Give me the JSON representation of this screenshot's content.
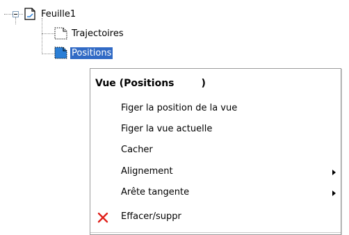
{
  "tree": {
    "root": {
      "label": "Feuille1",
      "expanded": true,
      "icon": "sheet-icon"
    },
    "children": [
      {
        "label": "Trajectoires",
        "icon": "view-icon",
        "selected": false
      },
      {
        "label": "Positions",
        "icon": "view-icon",
        "selected": true
      }
    ]
  },
  "context_menu": {
    "title": "Vue (Positions        )",
    "items": [
      {
        "label": "Figer la position de la vue",
        "submenu": false
      },
      {
        "label": "Figer la vue actuelle",
        "submenu": false
      },
      {
        "label": "Cacher",
        "submenu": false
      },
      {
        "label": "Alignement",
        "submenu": true
      },
      {
        "label": "Arête tangente",
        "submenu": true
      },
      {
        "label": "Effacer/suppr",
        "submenu": false,
        "icon": "delete-x-icon"
      }
    ]
  },
  "colors": {
    "selection": "#316ac5",
    "delete_icon": "#e0201a",
    "view_icon_fill": "#2b7fd6"
  }
}
